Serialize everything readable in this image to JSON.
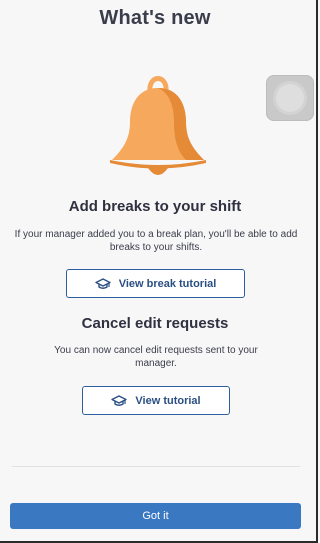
{
  "header": {
    "title": "What's new"
  },
  "illustration": {
    "icon": "bell-icon",
    "colors": {
      "bell_light": "#f6a95d",
      "bell_dark": "#e58a36"
    }
  },
  "floating_button": {
    "icon": "assistive-touch-icon"
  },
  "sections": [
    {
      "title": "Add breaks to your shift",
      "description": "If your manager added you to a break plan, you'll be able to add breaks to your shifts.",
      "button_label": "View break tutorial",
      "button_icon": "graduation-cap-icon"
    },
    {
      "title": "Cancel edit requests",
      "description": "You can now cancel edit requests sent to your manager.",
      "button_label": "View tutorial",
      "button_icon": "graduation-cap-icon"
    }
  ],
  "footer": {
    "button_label": "Got it"
  },
  "colors": {
    "primary": "#3a78c2",
    "outline": "#2f5e9e",
    "text": "#3a3d4a"
  }
}
